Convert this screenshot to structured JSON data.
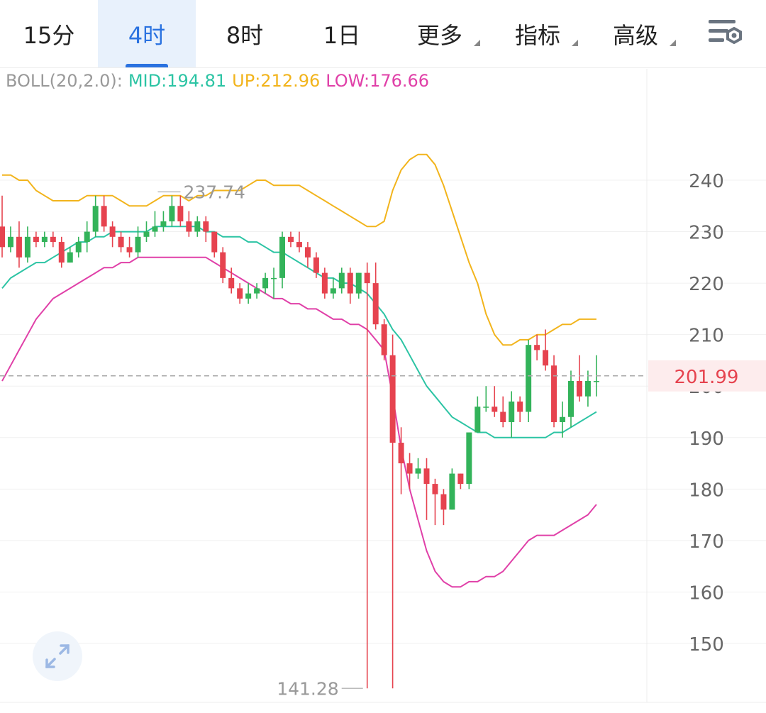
{
  "tabs": [
    {
      "label": "15分",
      "active": false,
      "dropdown": false
    },
    {
      "label": "4时",
      "active": true,
      "dropdown": false
    },
    {
      "label": "8时",
      "active": false,
      "dropdown": false
    },
    {
      "label": "1日",
      "active": false,
      "dropdown": false
    },
    {
      "label": "更多",
      "active": false,
      "dropdown": true
    },
    {
      "label": "指标",
      "active": false,
      "dropdown": true
    },
    {
      "label": "高级",
      "active": false,
      "dropdown": true
    }
  ],
  "icons": {
    "settings": "chart-settings-icon",
    "expand": "expand-arrows-icon"
  },
  "legend": {
    "indicator": "BOLL(20,2.0):",
    "mid": "MID:194.81",
    "up": "UP:212.96",
    "low": "LOW:176.66"
  },
  "colors": {
    "up_candle": "#33b35a",
    "down_candle": "#e6434f",
    "mid": "#2cc4a4",
    "upper": "#f2b41c",
    "lower": "#e040a8",
    "accent": "#2a72e0",
    "current_price": "#e6434f",
    "axis_text": "#666666"
  },
  "chart_data": {
    "type": "candlestick",
    "indicator": "BOLL(20,2.0)",
    "y_ticks": [
      150,
      160,
      170,
      180,
      190,
      200,
      210,
      220,
      230,
      240
    ],
    "ylim": [
      141,
      245
    ],
    "current_price": 201.99,
    "current_price_label": "201.99",
    "high_label": "237.74",
    "high_value": 237.74,
    "high_index": 18,
    "low_label": "141.28",
    "low_value": 141.28,
    "low_index": 43,
    "candles": [
      [
        231,
        227,
        237,
        225
      ],
      [
        227,
        229,
        231,
        226
      ],
      [
        229,
        225,
        232,
        223
      ],
      [
        225,
        229,
        231,
        224
      ],
      [
        229,
        228,
        230,
        227
      ],
      [
        228,
        229,
        230,
        227
      ],
      [
        229,
        228,
        230,
        227
      ],
      [
        228,
        224,
        229,
        223
      ],
      [
        224,
        226,
        227,
        224
      ],
      [
        226,
        228,
        229,
        225
      ],
      [
        228,
        230,
        232,
        226
      ],
      [
        230,
        235,
        237,
        229
      ],
      [
        235,
        231,
        237,
        230
      ],
      [
        231,
        229,
        232,
        227
      ],
      [
        229,
        227,
        230,
        226
      ],
      [
        227,
        226,
        229,
        225
      ],
      [
        226,
        229,
        231,
        225
      ],
      [
        229,
        230,
        232,
        228
      ],
      [
        230,
        231,
        234,
        229
      ],
      [
        231,
        232,
        234,
        230
      ],
      [
        232,
        235,
        237,
        231
      ],
      [
        235,
        232,
        237,
        231
      ],
      [
        232,
        230,
        234,
        229
      ],
      [
        230,
        232,
        233,
        229
      ],
      [
        232,
        230,
        233,
        228
      ],
      [
        230,
        226,
        230,
        225
      ],
      [
        226,
        221,
        227,
        220
      ],
      [
        221,
        219,
        223,
        218
      ],
      [
        219,
        217,
        220,
        216
      ],
      [
        217,
        218,
        220,
        216
      ],
      [
        218,
        219,
        220,
        217
      ],
      [
        219,
        221,
        222,
        218
      ],
      [
        221,
        221,
        223,
        217
      ],
      [
        221,
        229,
        230,
        219
      ],
      [
        229,
        228,
        230,
        227
      ],
      [
        228,
        227,
        230,
        226
      ],
      [
        227,
        225,
        228,
        223
      ],
      [
        225,
        222,
        226,
        221
      ],
      [
        222,
        218,
        223,
        217
      ],
      [
        218,
        219,
        221,
        217
      ],
      [
        219,
        222,
        223,
        218
      ],
      [
        222,
        218,
        223,
        216
      ],
      [
        218,
        222,
        222,
        217
      ],
      [
        222,
        220,
        224,
        141.28
      ],
      [
        220,
        212,
        224,
        211
      ],
      [
        212,
        206,
        213,
        205
      ],
      [
        206,
        189,
        210,
        141.28
      ],
      [
        189,
        185,
        192,
        179
      ],
      [
        185,
        183,
        187,
        180
      ],
      [
        183,
        184,
        186,
        182
      ],
      [
        184,
        181,
        186,
        174
      ],
      [
        181,
        179,
        182,
        173
      ],
      [
        179,
        176,
        180,
        173
      ],
      [
        176,
        183,
        184,
        176
      ],
      [
        183,
        181,
        183,
        180
      ],
      [
        181,
        191,
        191,
        180
      ],
      [
        191,
        196,
        198,
        191
      ],
      [
        196,
        196,
        200,
        195
      ],
      [
        196,
        195,
        200,
        194
      ],
      [
        195,
        193,
        198,
        192
      ],
      [
        193,
        197,
        199,
        190
      ],
      [
        197,
        195,
        198,
        193
      ],
      [
        195,
        208,
        209,
        193
      ],
      [
        208,
        207,
        210,
        205
      ],
      [
        207,
        204,
        211,
        203
      ],
      [
        204,
        193,
        206,
        192
      ],
      [
        193,
        194,
        197,
        190
      ],
      [
        194,
        201,
        203,
        192
      ],
      [
        201,
        198,
        206,
        197
      ],
      [
        198,
        201,
        203,
        196
      ],
      [
        201,
        201,
        206,
        198
      ]
    ],
    "boll_up": [
      241,
      241,
      240,
      240,
      238,
      237,
      236,
      236,
      236,
      236,
      237,
      237,
      237,
      237,
      236,
      235,
      235,
      235,
      236,
      237,
      237,
      237,
      236,
      237,
      237,
      238,
      238,
      238,
      238,
      239,
      240,
      240,
      239,
      239,
      239,
      239,
      238,
      237,
      236,
      235,
      234,
      233,
      232,
      231,
      231,
      232,
      238,
      242,
      244,
      245,
      245,
      243,
      239,
      234,
      229,
      224,
      220,
      214,
      210,
      208,
      208,
      209,
      209,
      210,
      210,
      211,
      212,
      212,
      213,
      213,
      213
    ],
    "boll_mid": [
      219,
      221,
      222,
      223,
      224,
      224,
      225,
      226,
      227,
      228,
      228,
      229,
      229,
      230,
      230,
      230,
      230,
      230,
      231,
      231,
      231,
      231,
      231,
      231,
      230,
      230,
      229,
      229,
      229,
      228,
      228,
      227,
      226,
      226,
      225,
      224,
      223,
      222,
      221,
      221,
      220,
      220,
      219,
      218,
      216,
      214,
      211,
      209,
      206,
      203,
      200,
      198,
      196,
      194,
      193,
      192,
      191,
      191,
      190,
      190,
      190,
      190,
      190,
      190,
      190,
      191,
      191,
      192,
      193,
      194,
      195
    ],
    "boll_low": [
      201,
      204,
      207,
      210,
      213,
      215,
      217,
      218,
      219,
      220,
      221,
      222,
      223,
      223,
      224,
      224,
      225,
      225,
      225,
      225,
      225,
      225,
      225,
      225,
      225,
      224,
      223,
      222,
      221,
      220,
      219,
      218,
      217,
      217,
      216,
      216,
      215,
      215,
      214,
      213,
      213,
      212,
      212,
      211,
      209,
      207,
      198,
      188,
      180,
      174,
      168,
      164,
      162,
      161,
      161,
      162,
      162,
      163,
      163,
      164,
      166,
      168,
      170,
      171,
      171,
      171,
      172,
      173,
      174,
      175,
      177
    ]
  }
}
